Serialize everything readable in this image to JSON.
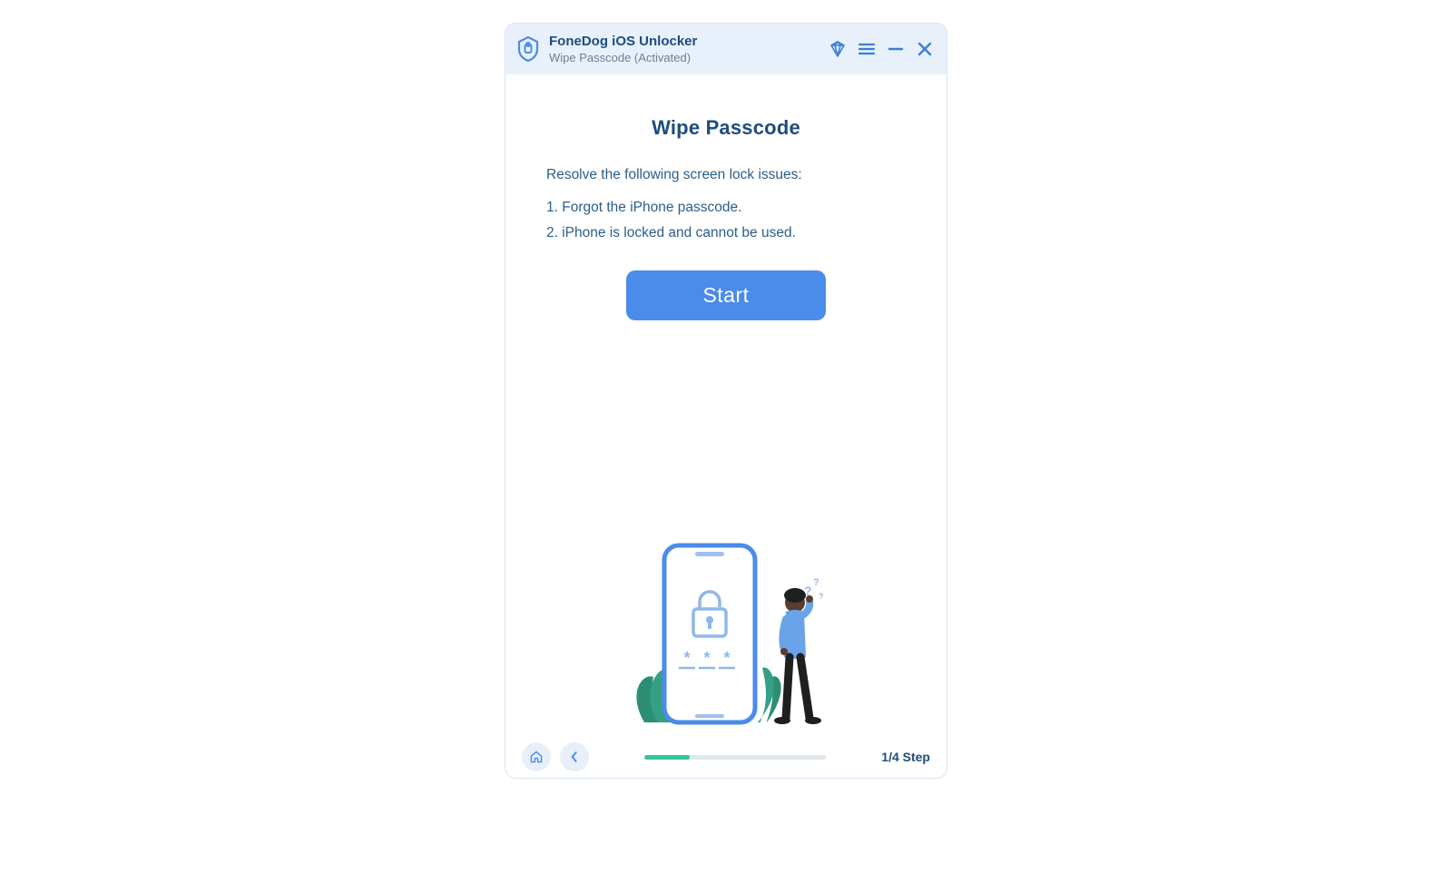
{
  "titlebar": {
    "app_title": "FoneDog iOS Unlocker",
    "subtitle": "Wipe Passcode  (Activated)"
  },
  "main": {
    "heading": "Wipe Passcode",
    "lead": "Resolve the following screen lock issues:",
    "issue1": "1. Forgot the iPhone passcode.",
    "issue2": "2. iPhone is locked and cannot be used.",
    "start_label": "Start"
  },
  "footer": {
    "step_label": "1/4 Step",
    "progress_pct": 25
  },
  "colors": {
    "accent": "#4b8bea",
    "header_bg": "#e8f1fb",
    "text_primary": "#1e4c7e",
    "text_muted": "#6b7f99",
    "progress_fill": "#2fc59a"
  }
}
